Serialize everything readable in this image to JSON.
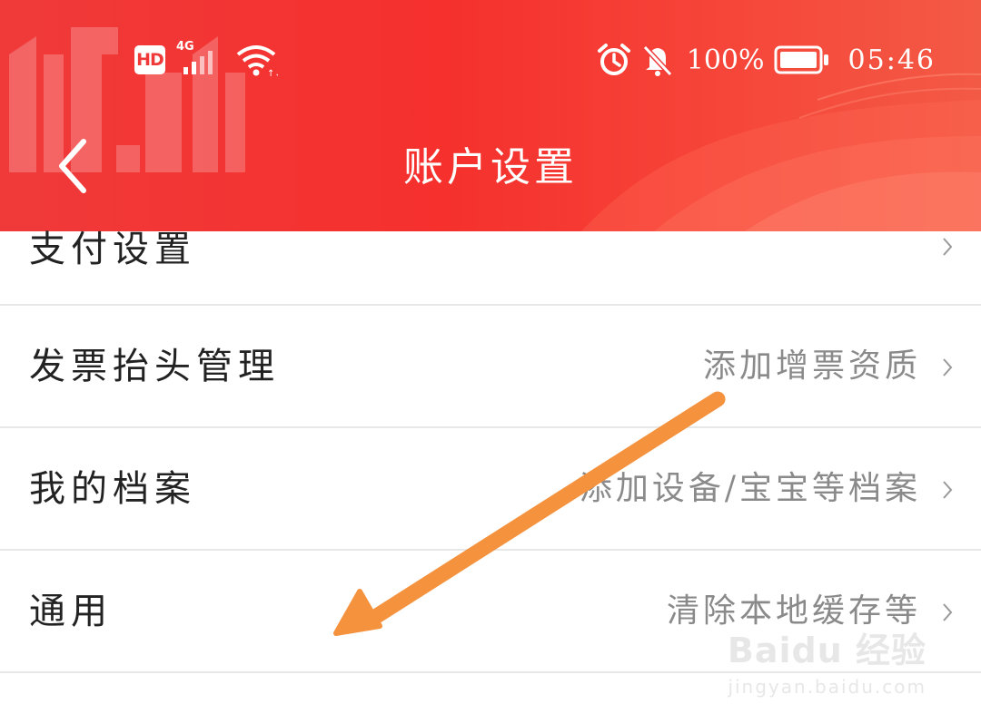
{
  "status_bar": {
    "hd_label": "HD",
    "network_label": "4G",
    "battery_percent": "100%",
    "time": "05:46"
  },
  "header": {
    "title": "账户设置",
    "decoration_text": "11.11"
  },
  "settings": {
    "rows": [
      {
        "label": "支付设置",
        "value": ""
      },
      {
        "label": "发票抬头管理",
        "value": "添加增票资质"
      },
      {
        "label": "我的档案",
        "value": "添加设备/宝宝等档案"
      },
      {
        "label": "通用",
        "value": "清除本地缓存等"
      }
    ]
  },
  "watermark": {
    "brand": "Baidu 经验",
    "url": "jingyan.baidu.com"
  },
  "colors": {
    "header_red": "#f5302d",
    "arrow_orange": "#f5923e",
    "row_label": "#222222",
    "row_value": "#8a8a8a",
    "divider": "#e7e7e7"
  },
  "icons": [
    "back-arrow-icon",
    "alarm-icon",
    "mute-bell-icon",
    "battery-icon",
    "wifi-icon",
    "signal-icon",
    "chevron-right-icon"
  ]
}
